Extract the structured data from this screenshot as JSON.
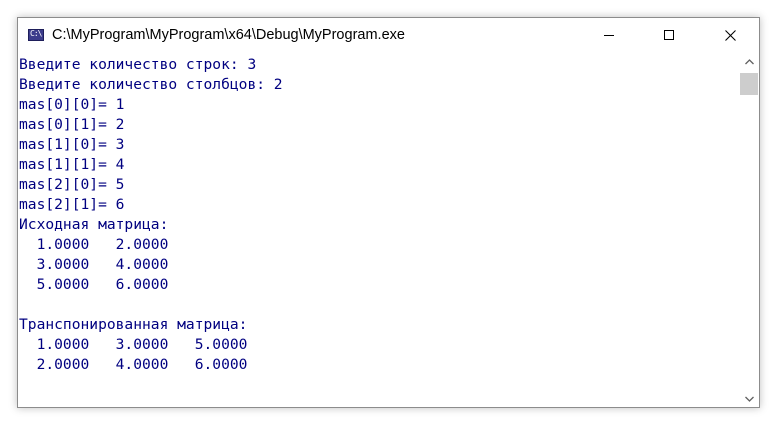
{
  "window": {
    "title": "C:\\MyProgram\\MyProgram\\x64\\Debug\\MyProgram.exe",
    "icon": "console-app-icon",
    "icon_text": "C:\\"
  },
  "controls": {
    "minimize": "minimize-icon",
    "maximize": "maximize-icon",
    "close": "close-icon"
  },
  "console": {
    "text_color": "#000080",
    "lines": [
      "Введите количество строк: 3",
      "Введите количество столбцов: 2",
      "mas[0][0]= 1",
      "mas[0][1]= 2",
      "mas[1][0]= 3",
      "mas[1][1]= 4",
      "mas[2][0]= 5",
      "mas[2][1]= 6",
      "Исходная матрица:",
      "  1.0000   2.0000",
      "  3.0000   4.0000",
      "  5.0000   6.0000",
      "",
      "Транспонированная матрица:",
      "  1.0000   3.0000   5.0000",
      "  2.0000   4.0000   6.0000"
    ]
  },
  "scrollbar": {
    "up_icon": "chevron-up-icon",
    "down_icon": "chevron-down-icon"
  }
}
